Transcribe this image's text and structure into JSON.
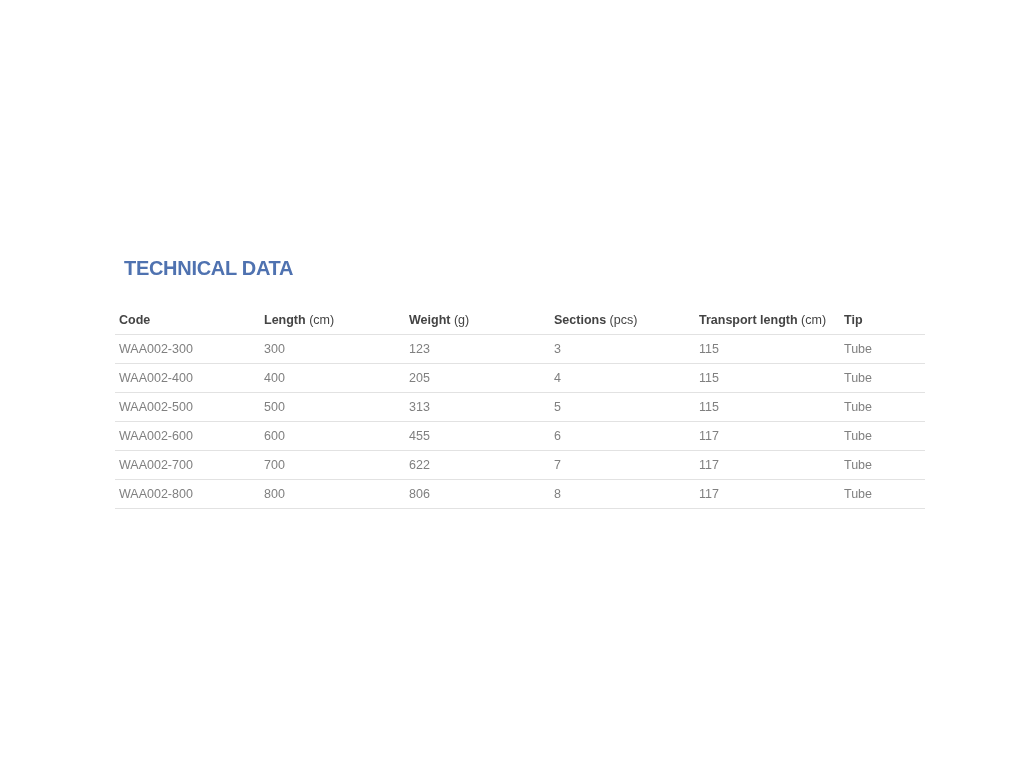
{
  "title": "TECHNICAL DATA",
  "table": {
    "columns": [
      "**Code**",
      "**Length** (cm)",
      "**Weight** (g)",
      "**Sections** (pcs)",
      "**Transport length** (cm)",
      "**Tip**"
    ],
    "rows": [
      [
        "WAA002-300",
        "300",
        "123",
        "3",
        "115",
        "Tube"
      ],
      [
        "WAA002-400",
        "400",
        "205",
        "4",
        "115",
        "Tube"
      ],
      [
        "WAA002-500",
        "500",
        "313",
        "5",
        "115",
        "Tube"
      ],
      [
        "WAA002-600",
        "600",
        "455",
        "6",
        "117",
        "Tube"
      ],
      [
        "WAA002-700",
        "700",
        "622",
        "7",
        "117",
        "Tube"
      ],
      [
        "WAA002-800",
        "800",
        "806",
        "8",
        "117",
        "Tube"
      ]
    ]
  }
}
